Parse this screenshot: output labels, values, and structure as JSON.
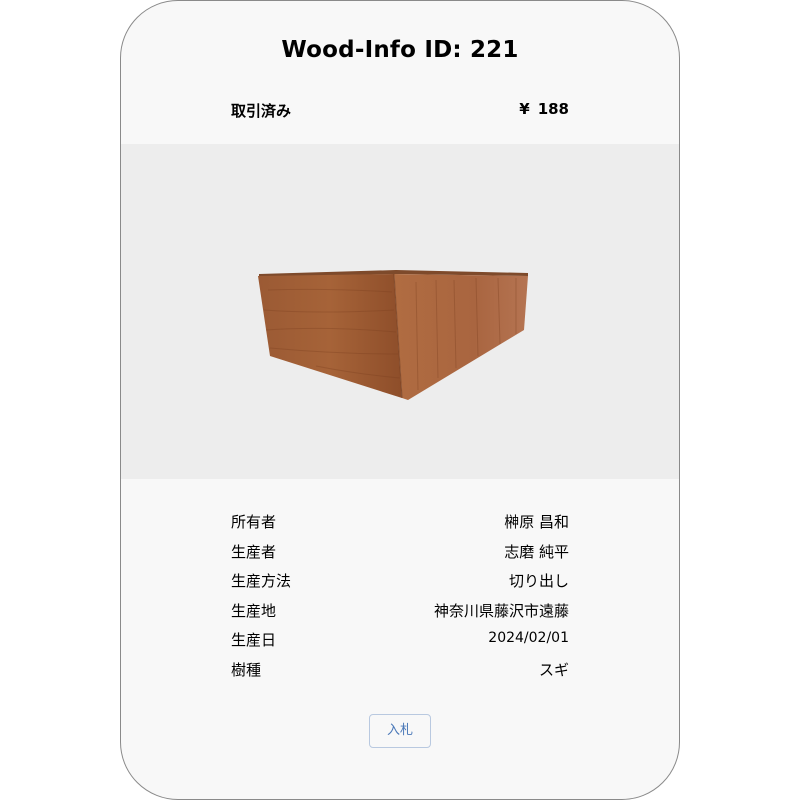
{
  "card": {
    "title": "Wood-Info ID: 221",
    "status": "取引済み",
    "price_symbol": "¥",
    "price_value": "188"
  },
  "info": {
    "rows": [
      {
        "label": "所有者",
        "value": "榊原 昌和"
      },
      {
        "label": "生産者",
        "value": "志磨 純平"
      },
      {
        "label": "生産方法",
        "value": "切り出し"
      },
      {
        "label": "生産地",
        "value": "神奈川県藤沢市遠藤"
      },
      {
        "label": "生産日",
        "value": "2024/02/01"
      },
      {
        "label": "樹種",
        "value": "スギ"
      }
    ]
  },
  "actions": {
    "bid_label": "入札"
  },
  "colors": {
    "card_background": "#f8f8f8",
    "image_background": "#ededed",
    "button_text": "#4a78b8",
    "button_border": "#b9c9e0",
    "wood": "#a0582f"
  }
}
